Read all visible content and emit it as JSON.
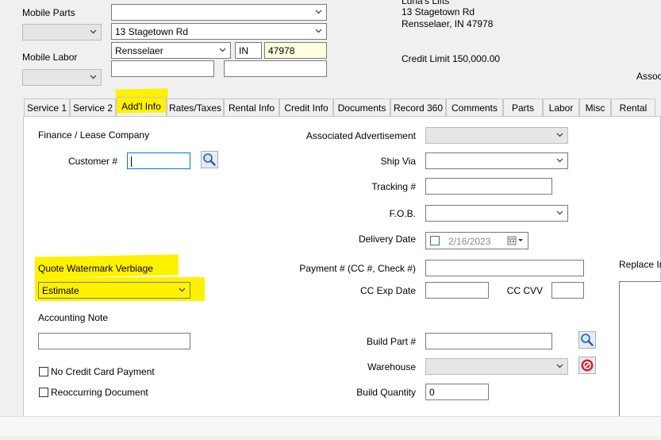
{
  "header": {
    "mobile_parts_label": "Mobile Parts",
    "mobile_labor_label": "Mobile Labor",
    "mobile_parts_value": "",
    "mobile_labor_value": "",
    "addr_line1_value": "",
    "addr_line2_value": "13 Stagetown Rd",
    "city_value": "Rensselaer",
    "state_value": "IN",
    "zip_value": "47978",
    "extra1_value": "",
    "extra2_value": "",
    "company_name_partial": "Luna's Lifts",
    "company_address": "13 Stagetown Rd",
    "company_city": "Rensselaer,  IN  47978",
    "credit_limit": "Credit Limit 150,000.00",
    "assoc_partial": "Assoc"
  },
  "tabs": [
    "Service 1",
    "Service 2",
    "Add'l Info",
    "Rates/Taxes",
    "Rental Info",
    "Credit Info",
    "Documents",
    "Record 360",
    "Comments",
    "Parts",
    "Labor",
    "Misc",
    "Rental"
  ],
  "active_tab": "Add'l Info",
  "form": {
    "finance_lease_label": "Finance / Lease Company",
    "customer_num_label": "Customer #",
    "customer_num_value": "",
    "associated_ad_label": "Associated Advertisement",
    "associated_ad_value": "",
    "ship_via_label": "Ship Via",
    "ship_via_value": "",
    "tracking_label": "Tracking #",
    "tracking_value": "",
    "fob_label": "F.O.B.",
    "fob_value": "",
    "delivery_date_label": "Delivery Date",
    "delivery_date_value": "2/16/2023",
    "quote_watermark_label": "Quote Watermark Verbiage",
    "quote_watermark_value": "Estimate",
    "payment_label": "Payment # (CC #, Check #)",
    "payment_value": "",
    "cc_exp_label": "CC Exp Date",
    "cc_exp_value": "",
    "cc_cvv_label": "CC CVV",
    "cc_cvv_value": "",
    "accounting_note_label": "Accounting Note",
    "accounting_note_value": "",
    "build_part_label": "Build Part #",
    "build_part_value": "",
    "warehouse_label": "Warehouse",
    "warehouse_value": "",
    "build_qty_label": "Build Quantity",
    "build_qty_value": "0",
    "no_credit_card_label": "No Credit Card Payment",
    "reoccurring_label": "Reoccurring Document",
    "replace_label_partial": "Replace In"
  },
  "icons": {
    "search": "search-icon",
    "delete": "delete-icon",
    "calendar": "calendar-icon"
  },
  "colors": {
    "highlight": "#fff200",
    "zip_bg": "#ffffe0",
    "focus_border": "#0078d7",
    "delete_red": "#d8232a"
  }
}
